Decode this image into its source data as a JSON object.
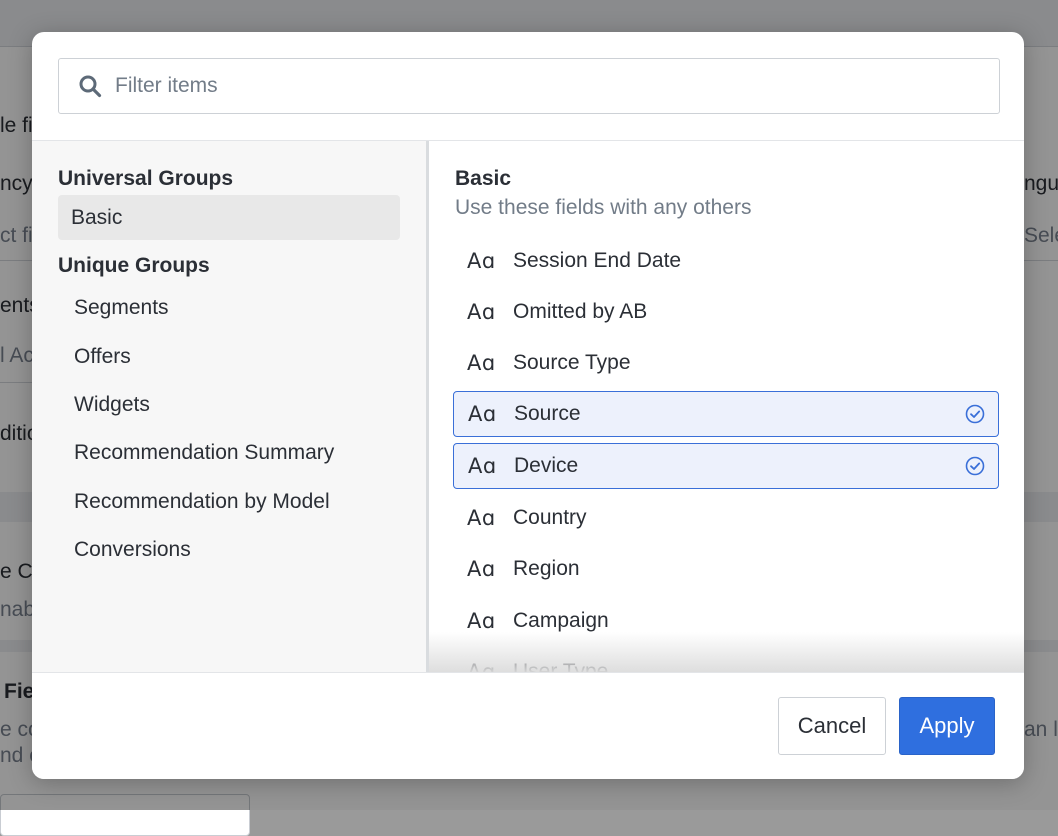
{
  "background": {
    "fragments": [
      "le fi",
      "ncy",
      "ct fi",
      "ents",
      "l Ac",
      "ditio",
      "e Cu",
      "nab",
      "Fie",
      "e co",
      "nd c",
      "ngu",
      "Sele",
      "an l"
    ]
  },
  "search": {
    "placeholder": "Filter items",
    "value": ""
  },
  "left_panel": {
    "universal_heading": "Universal Groups",
    "universal_items": [
      {
        "label": "Basic",
        "selected": true
      }
    ],
    "unique_heading": "Unique Groups",
    "unique_items": [
      {
        "label": "Segments"
      },
      {
        "label": "Offers"
      },
      {
        "label": "Widgets"
      },
      {
        "label": "Recommendation Summary"
      },
      {
        "label": "Recommendation by Model"
      },
      {
        "label": "Conversions"
      }
    ]
  },
  "right_panel": {
    "title": "Basic",
    "subtitle": "Use these fields with any others",
    "type_icon_text": "Aɑ",
    "fields": [
      {
        "label": "Session End Date",
        "selected": false
      },
      {
        "label": "Omitted by AB",
        "selected": false
      },
      {
        "label": "Source Type",
        "selected": false
      },
      {
        "label": "Source",
        "selected": true
      },
      {
        "label": "Device",
        "selected": true
      },
      {
        "label": "Country",
        "selected": false
      },
      {
        "label": "Region",
        "selected": false
      },
      {
        "label": "Campaign",
        "selected": false
      },
      {
        "label": "User Type",
        "selected": false
      }
    ]
  },
  "footer": {
    "cancel_label": "Cancel",
    "apply_label": "Apply"
  },
  "colors": {
    "accent": "#2f6fdf",
    "selected_bg": "#edf1fc",
    "selected_border": "#3a6fd8"
  }
}
